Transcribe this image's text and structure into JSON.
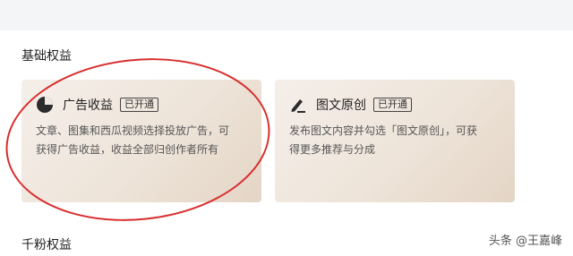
{
  "sections": {
    "basic_title": "基础权益",
    "fans_title": "千粉权益"
  },
  "cards": [
    {
      "title": "广告收益",
      "badge": "已开通",
      "icon": "pie-chart-icon",
      "desc_line1": "文章、图集和西瓜视频选择投放广告，可",
      "desc_line2": "获得广告收益，收益全部归创作者所有"
    },
    {
      "title": "图文原创",
      "badge": "已开通",
      "icon": "pen-icon",
      "desc_line1": "发布图文内容并勾选「图文原创」，可获",
      "desc_line2": "得更多推荐与分成"
    }
  ],
  "watermark": "头条 @王嘉峰",
  "colors": {
    "annotation": "#d82e2e",
    "card_bg": "#eee4d9"
  }
}
